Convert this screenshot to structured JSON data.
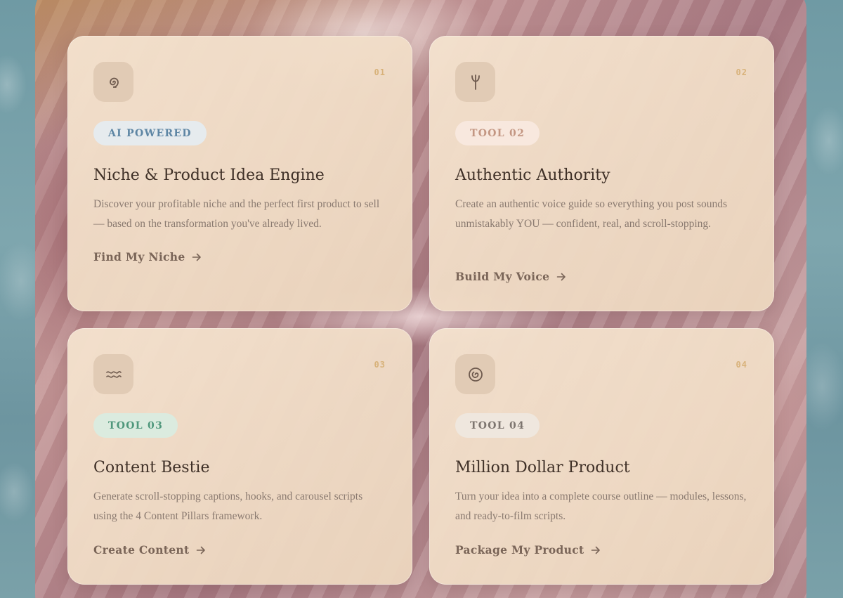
{
  "cards": [
    {
      "number": "01",
      "icon": "spiral-icon",
      "badge": "AI POWERED",
      "title": "Niche & Product Idea Engine",
      "description": "Discover your profitable niche and the perfect first product to sell — based on the transformation you've already lived.",
      "link": "Find My Niche"
    },
    {
      "number": "02",
      "icon": "sprout-icon",
      "badge": "TOOL 02",
      "title": "Authentic Authority",
      "description": "Create an authentic voice guide so everything you post sounds unmistakably YOU — confident, real, and scroll-stopping.",
      "link": "Build My Voice"
    },
    {
      "number": "03",
      "icon": "waves-icon",
      "badge": "TOOL 03",
      "title": "Content Bestie",
      "description": "Generate scroll-stopping captions, hooks, and carousel scripts using the 4 Content Pillars framework.",
      "link": "Create Content"
    },
    {
      "number": "04",
      "icon": "swirl-icon",
      "badge": "TOOL 04",
      "title": "Million Dollar Product",
      "description": "Turn your idea into a complete course outline — modules, lessons, and ready-to-film scripts.",
      "link": "Package My Product"
    }
  ],
  "colors": {
    "badge_blue": "#5e86a4",
    "badge_peach": "#c39682",
    "badge_mint": "#4f977b",
    "badge_grey": "#7d756f",
    "number": "#d8b27a"
  }
}
